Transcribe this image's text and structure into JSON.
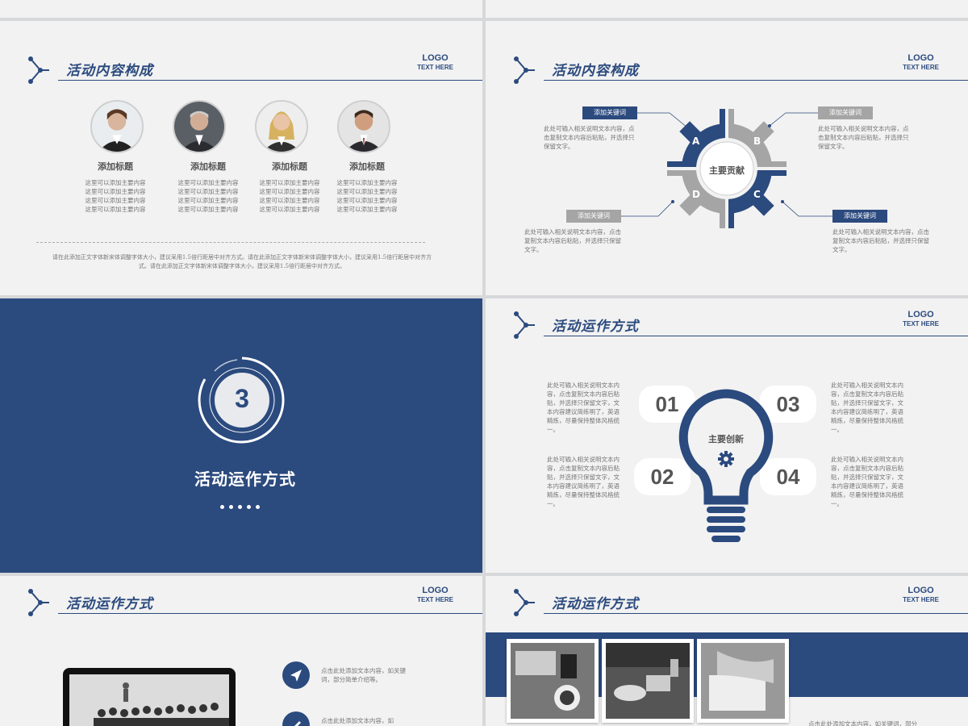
{
  "logo": {
    "line1": "LOGO",
    "line2": "TEXT HERE"
  },
  "slide_team": {
    "title": "活动内容构成",
    "people": [
      {
        "title": "添加标题",
        "text": "这里可以添加主要内容这里可以添加主要内容这里可以添加主要内容这里可以添加主要内容"
      },
      {
        "title": "添加标题",
        "text": "这里可以添加主要内容这里可以添加主要内容这里可以添加主要内容这里可以添加主要内容"
      },
      {
        "title": "添加标题",
        "text": "这里可以添加主要内容这里可以添加主要内容这里可以添加主要内容这里可以添加主要内容"
      },
      {
        "title": "添加标题",
        "text": "这里可以添加主要内容这里可以添加主要内容这里可以添加主要内容这里可以添加主要内容"
      }
    ],
    "footer": "请在此添加正文字体新宋体调整字体大小，建议采用1.5倍行距居中对齐方式。请在此添加正文字体新宋体调整字体大小，建议采用1.5倍行距居中对齐方式。请在此添加正文字体新宋体调整字体大小，建议采用1.5倍行距居中对齐方式。"
  },
  "slide_gear": {
    "title": "活动内容构成",
    "center": "主要贡献",
    "letters": [
      "A",
      "B",
      "C",
      "D"
    ],
    "keywords": [
      "添加关键词",
      "添加关键词",
      "添加关键词",
      "添加关键词"
    ],
    "text": "此处可输入相关说明文本内容，点击复制文本内容后粘贴，并选择只保留文字。",
    "colors": {
      "blue": "#2b4a7e",
      "gray": "#a5a5a5"
    }
  },
  "slide_section": {
    "number": "3",
    "title": "活动运作方式"
  },
  "slide_bulb": {
    "title": "活动运作方式",
    "center": "主要创新",
    "numbers": [
      "01",
      "02",
      "03",
      "04"
    ],
    "text": "此处可输入相关说明文本内容，点击复制文本内容后粘贴，并选择只保留文字，文本内容建议简练明了，英语精炼，尽量保持整体风格统一。"
  },
  "slide_screen": {
    "title": "活动运作方式",
    "items": [
      {
        "icon": "send-icon",
        "text": "点击此处添加文本内容，如关键词，部分简单介绍等。"
      },
      {
        "icon": "pencil-icon",
        "text": "点击此处添加文本内容，如"
      }
    ]
  },
  "slide_photos": {
    "title": "活动运作方式",
    "text": "点击此处添加文本内容，如关键词，部分"
  }
}
